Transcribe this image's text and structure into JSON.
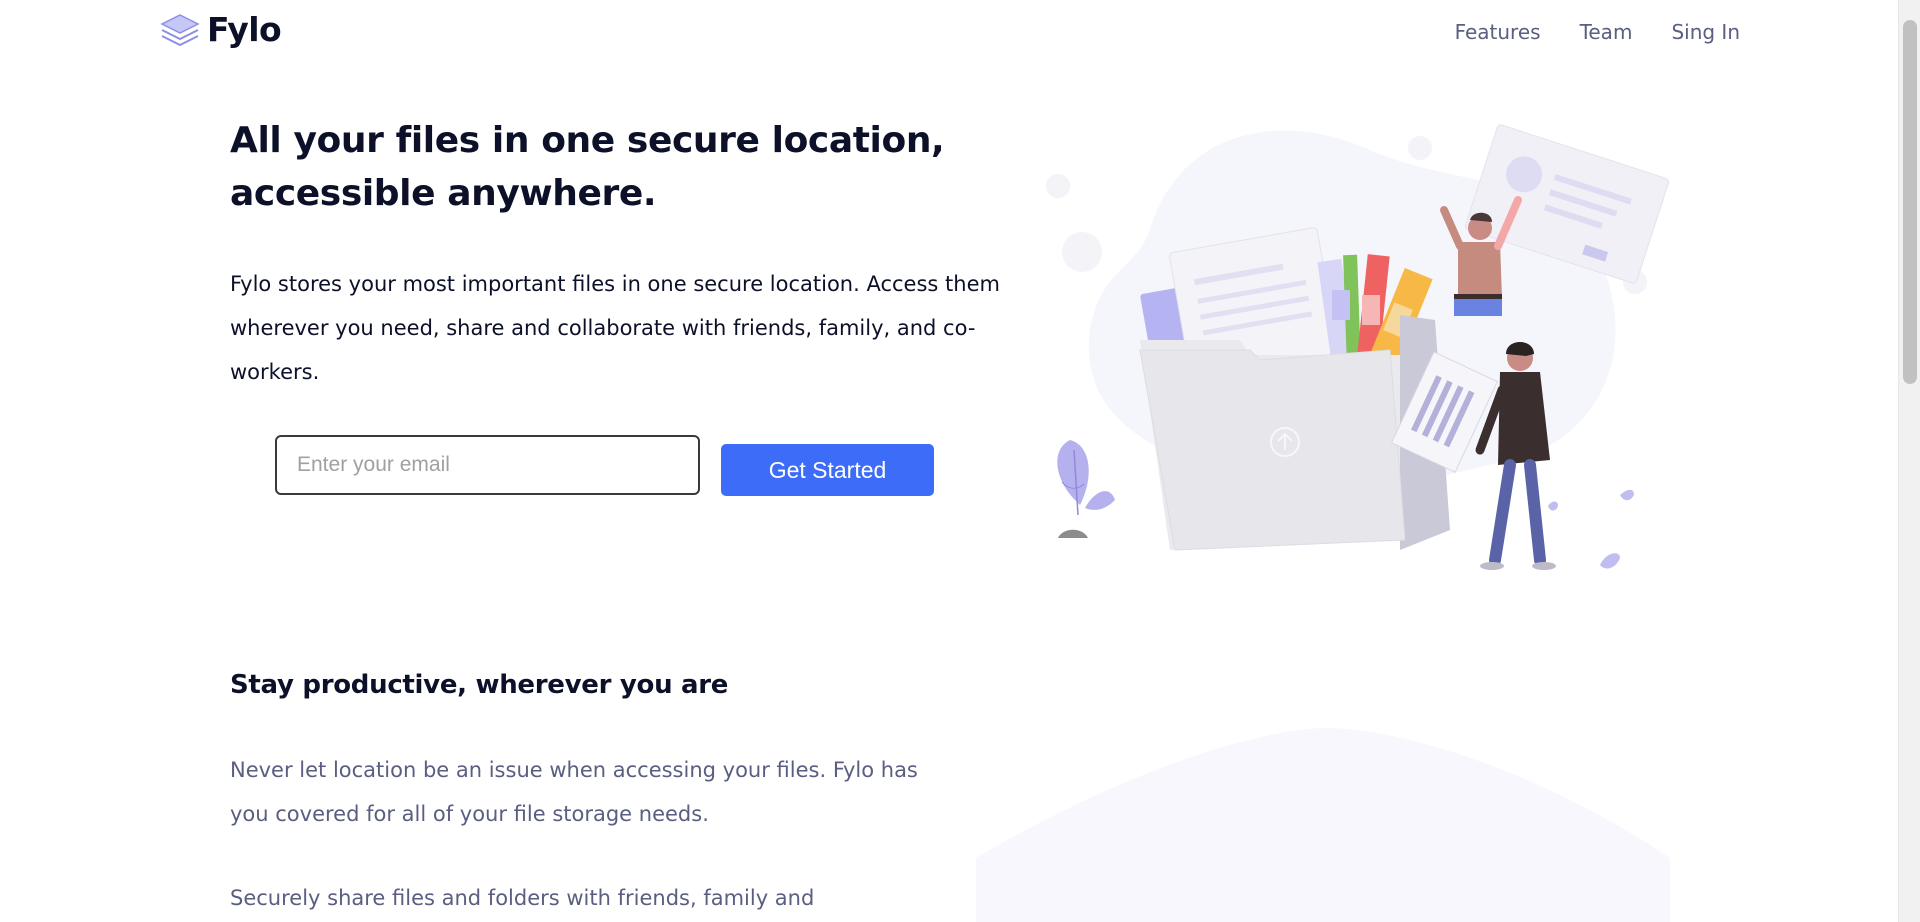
{
  "brand": {
    "name": "Fylo",
    "logo_icon": "stacked-layers-icon",
    "accent": "#3d6cf8",
    "dark": "#0c1029"
  },
  "nav": {
    "items": [
      {
        "label": "Features"
      },
      {
        "label": "Team"
      },
      {
        "label": "Sing In"
      }
    ]
  },
  "hero": {
    "title": "All your files in one secure location, accessible anywhere.",
    "description": "Fylo stores your most important files in one secure location. Access them wherever you need, share and collaborate with friends, family, and co-workers.",
    "email_placeholder": "Enter your email",
    "cta_label": "Get Started"
  },
  "productive": {
    "title": "Stay productive, wherever you are",
    "paragraph_1": "Never let location be an issue when accessing your files. Fylo has you covered for all of your file storage needs.",
    "paragraph_2": "Securely share files and folders with friends, family and"
  }
}
